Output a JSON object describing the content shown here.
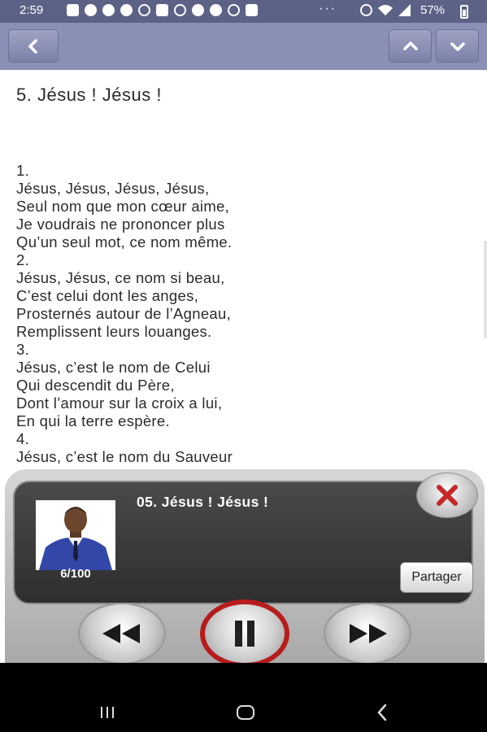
{
  "status_bar": {
    "time": "2:59",
    "overflow": "···",
    "battery": "57%",
    "left_icons": [
      "message-icon",
      "facebook-icon",
      "facebook-icon",
      "facebook-icon",
      "airplane-off-icon",
      "mail-icon",
      "voicemail-icon",
      "c-app-icon",
      "c-app-icon",
      "target-icon",
      "image-icon"
    ],
    "right_icons": [
      "mute-icon",
      "wifi-icon",
      "signal-icon"
    ]
  },
  "toolbar": {
    "back_icon": "chevron-left-icon",
    "up_icon": "chevron-up-icon",
    "down_icon": "chevron-down-icon"
  },
  "song": {
    "title": "5. Jésus ! Jésus !",
    "lyrics": [
      "1.",
      "Jésus, Jésus, Jésus, Jésus,",
      "Seul nom que mon cœur aime,",
      "Je voudrais ne prononcer plus",
      "Qu’un seul mot, ce nom même.",
      "2.",
      "Jésus, Jésus, ce nom si beau,",
      "C’est celui dont les anges,",
      "Prosternés autour de l’Agneau,",
      "Remplissent leurs louanges.",
      "3.",
      "Jésus, c’est le nom de Celui",
      "Qui descendit du Père,",
      "Dont l’amour sur la croix a lui,",
      "En qui la terre espère.",
      "4.",
      "Jésus, c’est le nom du Sauveur"
    ]
  },
  "player": {
    "track_title": "05. Jésus ! Jésus !",
    "counter": "6/100",
    "share_label": "Partager",
    "colors": {
      "accent_red": "#b71c1c",
      "screen": "#3a3a3a"
    }
  },
  "navbar": {
    "icons": [
      "recent-apps-icon",
      "home-icon",
      "back-icon"
    ]
  }
}
